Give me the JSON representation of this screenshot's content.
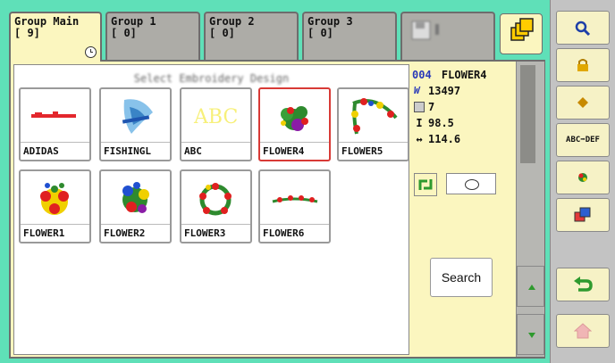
{
  "tabs": [
    {
      "name": "Group Main",
      "value": "[ 9]",
      "active": true
    },
    {
      "name": "Group 1",
      "value": "[ 0]",
      "active": false
    },
    {
      "name": "Group 2",
      "value": "[ 0]",
      "active": false
    },
    {
      "name": "Group 3",
      "value": "[ 0]",
      "active": false
    }
  ],
  "list": {
    "designs": [
      {
        "label": "ADIDAS",
        "selected": false
      },
      {
        "label": "FISHINGL",
        "selected": false
      },
      {
        "label": "ABC",
        "selected": false
      },
      {
        "label": "FLOWER4",
        "selected": true
      },
      {
        "label": "FLOWER5",
        "selected": false
      },
      {
        "label": "FLOWER1",
        "selected": false
      },
      {
        "label": "FLOWER2",
        "selected": false
      },
      {
        "label": "FLOWER3",
        "selected": false
      },
      {
        "label": "FLOWER6",
        "selected": false
      }
    ]
  },
  "info": {
    "number": "004",
    "name": "FLOWER4",
    "stitches": "13497",
    "colors": "7",
    "height": "98.5",
    "width": "114.6"
  },
  "search_label": "Search",
  "toolbar": {
    "abc_def_label": "ABC➡DEF"
  },
  "icons": {
    "zoom": "magnifier-icon",
    "lock": "lock-icon",
    "point": "diamond-icon",
    "rename": "abc-def-icon",
    "flower": "flower-icon",
    "copy": "copy-icon",
    "back": "back-arrow-icon",
    "home": "home-icon"
  }
}
